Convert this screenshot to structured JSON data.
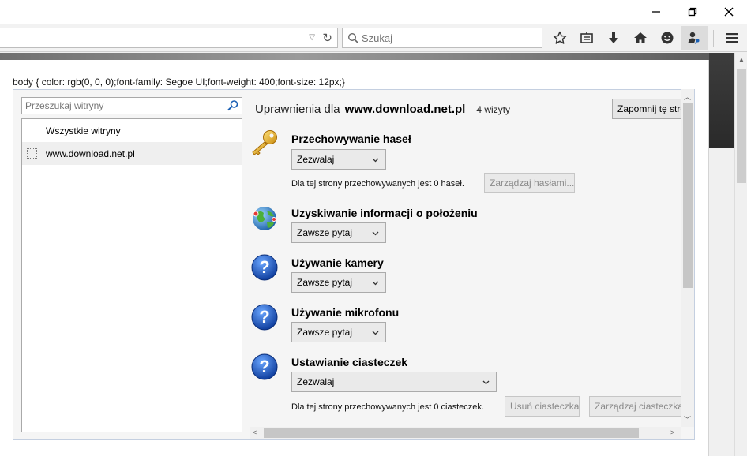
{
  "window": {
    "minimize": "—",
    "maximize": "❐",
    "close": "✕"
  },
  "toolbar": {
    "search_placeholder": "Szukaj",
    "icons": [
      "star-icon",
      "reading-list-icon",
      "download-icon",
      "home-icon",
      "emoji-icon",
      "user-key-icon",
      "hamburger-menu-icon"
    ]
  },
  "page": {
    "css_text": "body { color: rgb(0, 0, 0);font-family: Segoe UI;font-weight: 400;font-size: 12px;}"
  },
  "sidebar": {
    "search_placeholder": "Przeszukaj witryny",
    "items": [
      {
        "label": "Wszystkie witryny"
      },
      {
        "label": "www.download.net.pl"
      }
    ]
  },
  "permissions": {
    "heading_label": "Uprawnienia dla",
    "site": "www.download.net.pl",
    "visits": "4 wizyty",
    "forget_button": "Zapomnij tę stronę",
    "passwords": {
      "title": "Przechowywanie haseł",
      "value": "Zezwalaj",
      "note": "Dla tej strony przechowywanych jest 0 haseł.",
      "button": "Zarządzaj hasłami..."
    },
    "geolocation": {
      "title": "Uzyskiwanie informacji o położeniu",
      "value": "Zawsze pytaj"
    },
    "camera": {
      "title": "Używanie kamery",
      "value": "Zawsze pytaj"
    },
    "microphone": {
      "title": "Używanie mikrofonu",
      "value": "Zawsze pytaj"
    },
    "cookies": {
      "title": "Ustawianie ciasteczek",
      "value": "Zezwalaj",
      "note": "Dla tej strony przechowywanych jest 0 ciasteczek.",
      "remove_button": "Usuń ciasteczka",
      "manage_button": "Zarządzaj ciasteczkami"
    }
  }
}
